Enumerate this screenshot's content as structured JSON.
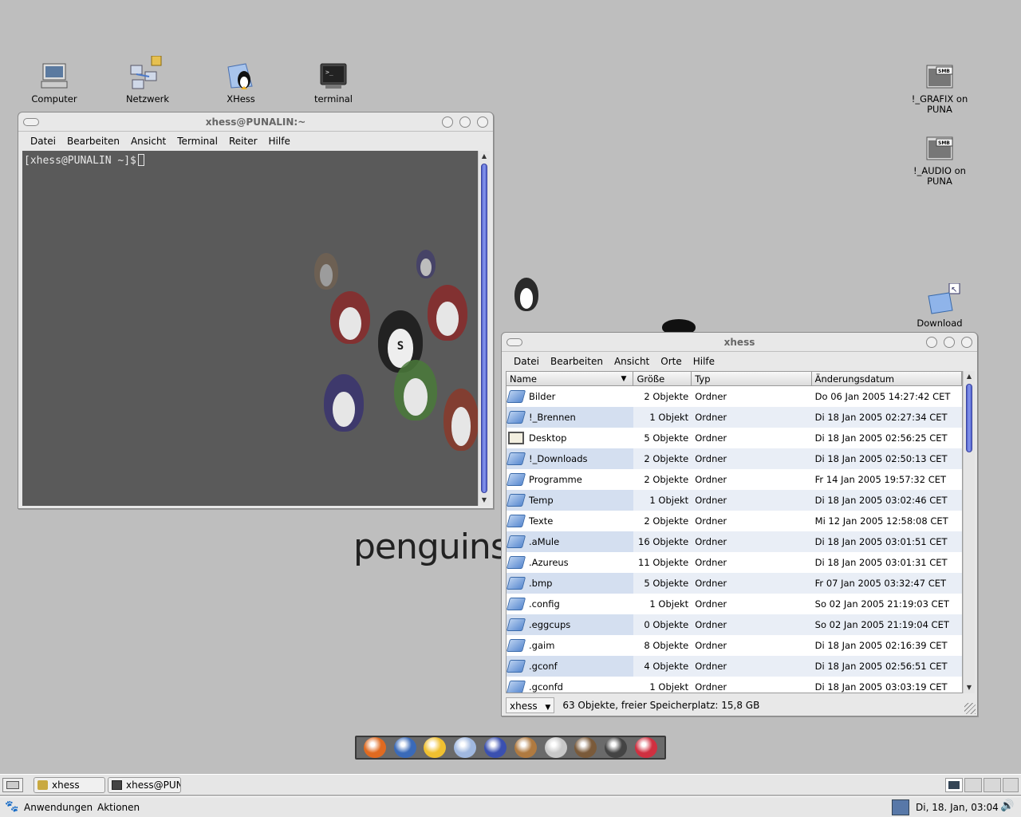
{
  "desktop": {
    "icons": [
      {
        "label": "Computer"
      },
      {
        "label": "Netzwerk"
      },
      {
        "label": "XHess"
      },
      {
        "label": "terminal"
      },
      {
        "label": "!_GRAFIX on PUNA"
      },
      {
        "label": "!_AUDIO on PUNA"
      },
      {
        "label": "Download"
      }
    ],
    "smb_badge": "SMB",
    "background_text": "penguins"
  },
  "terminal_window": {
    "title": "xhess@PUNALIN:~",
    "menu": [
      "Datei",
      "Bearbeiten",
      "Ansicht",
      "Terminal",
      "Reiter",
      "Hilfe"
    ],
    "prompt": "[xhess@PUNALIN ~]$"
  },
  "file_manager": {
    "title": "xhess",
    "menu": [
      "Datei",
      "Bearbeiten",
      "Ansicht",
      "Orte",
      "Hilfe"
    ],
    "columns": [
      "Name",
      "Größe",
      "Typ",
      "Änderungsdatum"
    ],
    "rows": [
      {
        "name": "Bilder",
        "size": "2 Objekte",
        "type": "Ordner",
        "date": "Do 06 Jan 2005 14:27:42 CET",
        "icon": "folder-icon"
      },
      {
        "name": "!_Brennen",
        "size": "1 Objekt",
        "type": "Ordner",
        "date": "Di 18 Jan 2005 02:27:34 CET",
        "icon": "folder-icon"
      },
      {
        "name": "Desktop",
        "size": "5 Objekte",
        "type": "Ordner",
        "date": "Di 18 Jan 2005 02:56:25 CET",
        "icon": "desktop-folder-icon"
      },
      {
        "name": "!_Downloads",
        "size": "2 Objekte",
        "type": "Ordner",
        "date": "Di 18 Jan 2005 02:50:13 CET",
        "icon": "folder-icon"
      },
      {
        "name": "Programme",
        "size": "2 Objekte",
        "type": "Ordner",
        "date": "Fr 14 Jan 2005 19:57:32 CET",
        "icon": "folder-icon"
      },
      {
        "name": "Temp",
        "size": "1 Objekt",
        "type": "Ordner",
        "date": "Di 18 Jan 2005 03:02:46 CET",
        "icon": "folder-icon"
      },
      {
        "name": "Texte",
        "size": "2 Objekte",
        "type": "Ordner",
        "date": "Mi 12 Jan 2005 12:58:08 CET",
        "icon": "folder-icon"
      },
      {
        "name": ".aMule",
        "size": "16 Objekte",
        "type": "Ordner",
        "date": "Di 18 Jan 2005 03:01:51 CET",
        "icon": "folder-icon"
      },
      {
        "name": ".Azureus",
        "size": "11 Objekte",
        "type": "Ordner",
        "date": "Di 18 Jan 2005 03:01:31 CET",
        "icon": "folder-icon"
      },
      {
        "name": ".bmp",
        "size": "5 Objekte",
        "type": "Ordner",
        "date": "Fr 07 Jan 2005 03:32:47 CET",
        "icon": "folder-icon"
      },
      {
        "name": ".config",
        "size": "1 Objekt",
        "type": "Ordner",
        "date": "So 02 Jan 2005 21:19:03 CET",
        "icon": "folder-icon"
      },
      {
        "name": ".eggcups",
        "size": "0 Objekte",
        "type": "Ordner",
        "date": "So 02 Jan 2005 21:19:04 CET",
        "icon": "folder-icon"
      },
      {
        "name": ".gaim",
        "size": "8 Objekte",
        "type": "Ordner",
        "date": "Di 18 Jan 2005 02:16:39 CET",
        "icon": "folder-icon"
      },
      {
        "name": ".gconf",
        "size": "4 Objekte",
        "type": "Ordner",
        "date": "Di 18 Jan 2005 02:56:51 CET",
        "icon": "folder-icon"
      },
      {
        "name": ".gconfd",
        "size": "1 Objekt",
        "type": "Ordner",
        "date": "Di 18 Jan 2005 03:03:19 CET",
        "icon": "folder-icon"
      }
    ],
    "location": "xhess",
    "status": "63 Objekte, freier Speicherplatz: 15,8 GB"
  },
  "dock": {
    "items": [
      "firefox-icon",
      "thunderbird-icon",
      "messenger-icon",
      "text-editor-icon",
      "penguin-tool-icon",
      "amule-icon",
      "cd-burner-icon",
      "video-player-icon",
      "music-player-icon",
      "disc-player-icon"
    ]
  },
  "taskbar": {
    "tasks": [
      {
        "label": "xhess",
        "icon": "file-manager-icon"
      },
      {
        "label": "xhess@PUN",
        "icon": "terminal-icon"
      }
    ]
  },
  "top_panel": {
    "menus": [
      "Anwendungen",
      "Aktionen"
    ],
    "clock": "Di, 18. Jan, 03:04"
  },
  "colors": {
    "desktop_bg": "#bebebe",
    "terminal_bg": "#5a5a5a",
    "scroll_thumb": "#5a6ad8",
    "row_alt": "#e9eef6"
  }
}
